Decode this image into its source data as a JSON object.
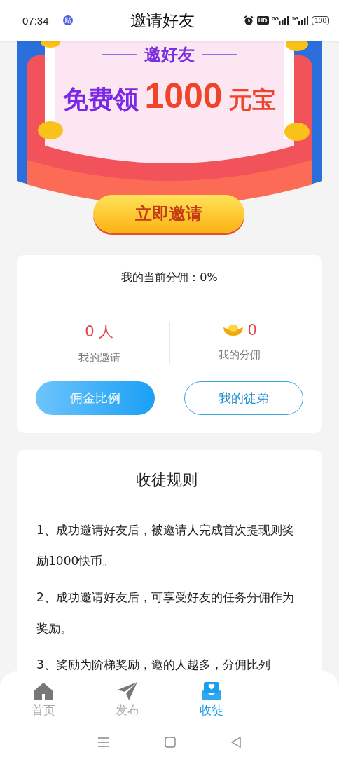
{
  "status_bar": {
    "time": "07:34",
    "notification_badge": "贴",
    "hd_label": "HD",
    "signals": [
      "5G",
      "5G"
    ],
    "battery": "100"
  },
  "header": {
    "title": "邀请好友"
  },
  "banner": {
    "subtitle": "邀好友",
    "headline_prefix": "免费领",
    "amount": "1000",
    "unit": "元宝",
    "invite_button": "立即邀请"
  },
  "stats_card": {
    "current_commission": "我的当前分佣：0%",
    "stats": [
      {
        "kind": "count",
        "value": "0 人",
        "label": "我的邀请"
      },
      {
        "kind": "ingot",
        "value": "0",
        "label": "我的分佣"
      }
    ],
    "buttons": [
      {
        "label": "佣金比例",
        "kind": "filled"
      },
      {
        "label": "我的徒弟",
        "kind": "outline"
      }
    ]
  },
  "rules_card": {
    "title": "收徒规则",
    "rules": [
      "1、成功邀请好友后，被邀请人完成首次提现则奖励1000快币。",
      "2、成功邀请好友后，可享受好友的任务分佣作为奖励。",
      "3、奖励为阶梯奖励，邀的人越多，分佣比列"
    ]
  },
  "tab_bar": [
    {
      "label": "首页",
      "kind": "home",
      "selected": false
    },
    {
      "label": "发布",
      "kind": "plane",
      "selected": false
    },
    {
      "label": "收徒",
      "kind": "mail",
      "selected": true
    }
  ]
}
